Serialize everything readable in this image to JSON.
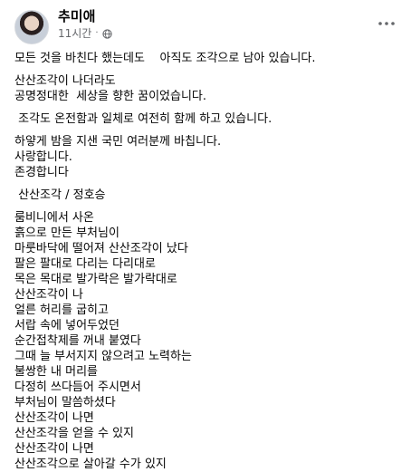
{
  "post": {
    "author": "추미애",
    "time": "11시간",
    "separator": "·",
    "icons": {
      "audience": "globe-icon",
      "more": "more-options-icon"
    },
    "paragraphs": [
      [
        "모든 것을 바친다 했는데도    아직도 조각으로 남아 있습니다."
      ],
      [
        "산산조각이 나더라도",
        "공명정대한  세상을 향한 꿈이었습니다."
      ],
      [
        " 조각도 온전함과 일체로 여전히 함께 하고 있습니다."
      ],
      [
        "하얗게 밤을 지샌 국민 여러분께 바칩니다.",
        "사랑합니다.",
        "존경합니다"
      ],
      [
        " 산산조각 / 정호승"
      ],
      [
        "룸비니에서 사온",
        "흙으로 만든 부처님이",
        "마룻바닥에 떨어져 산산조각이 났다",
        "팔은 팔대로 다리는 다리대로",
        "목은 목대로 발가락은 발가락대로",
        "산산조각이 나",
        "얼른 허리를 굽히고",
        "서랍 속에 넣어두었던",
        "순간접착제를 꺼내 붙였다",
        "그때 늘 부서지지 않으려고 노력하는",
        "불쌍한 내 머리를",
        "다정히 쓰다듬어 주시면서",
        "부처님이 말씀하셨다",
        "산산조각이 나면",
        "산산조각을 얻을 수 있지",
        "산산조각이 나면",
        "산산조각으로 살아갈 수가 있지"
      ]
    ]
  }
}
